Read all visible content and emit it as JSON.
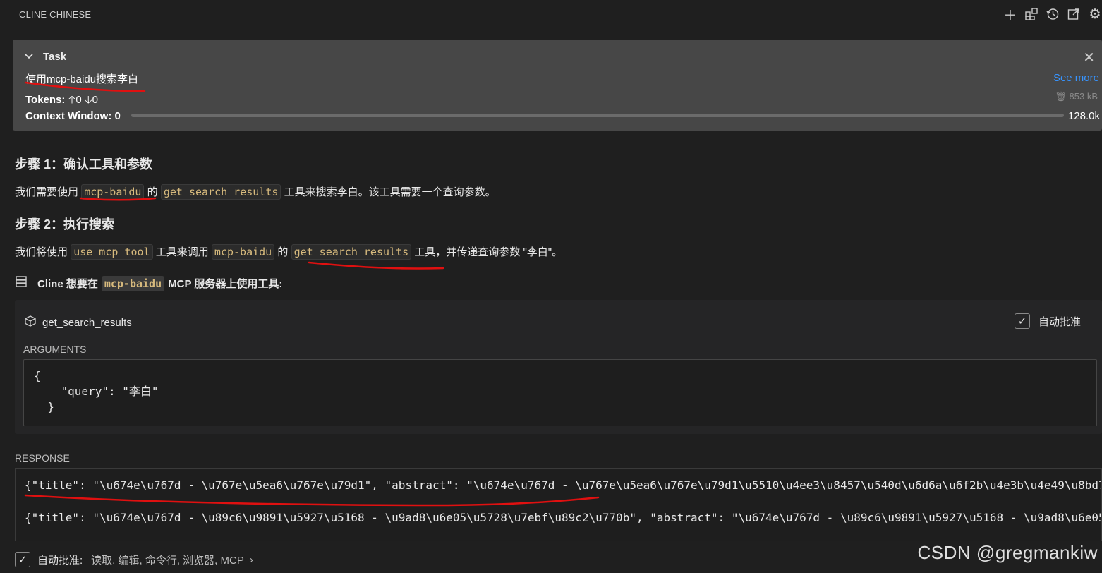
{
  "header": {
    "title": "CLINE CHINESE",
    "icons": [
      "plus-icon",
      "layout-icon",
      "history-icon",
      "popout-icon",
      "settings-icon"
    ]
  },
  "task": {
    "label": "Task",
    "text": "使用mcp-baidu搜索李白",
    "see_more": "See more",
    "tokens_label": "Tokens:",
    "tokens_up": "0",
    "tokens_down": "0",
    "size": "853 kB",
    "context_label": "Context Window:",
    "context_used": "0",
    "context_max": "128.0k",
    "context_fraction": 0
  },
  "step1": {
    "heading": "步骤 1：确认工具和参数",
    "p_pre": "我们需要使用",
    "code1": "mcp-baidu",
    "p_mid": "的",
    "code2": "get_search_results",
    "p_post": "工具来搜索李白。该工具需要一个查询参数。"
  },
  "step2": {
    "heading": "步骤 2：执行搜索",
    "p_pre": "我们将使用",
    "code1": "use_mcp_tool",
    "p_mid1": "工具来调用",
    "code2": "mcp-baidu",
    "p_mid2": "的",
    "code3": "get_search_results",
    "p_post": "工具，并传递查询参数 \"李白\"。"
  },
  "tool_header": {
    "pre": "Cline 想要在",
    "server": "mcp-baidu",
    "post": "MCP 服务器上使用工具:"
  },
  "tool_card": {
    "name": "get_search_results",
    "auto_approve": "自动批准",
    "arguments_label": "ARGUMENTS",
    "arguments_code": "{\n    \"query\": \"李白\"\n  }"
  },
  "response": {
    "label": "RESPONSE",
    "line1": "{\"title\": \"\\u674e\\u767d - \\u767e\\u5ea6\\u767e\\u79d1\", \"abstract\": \"\\u674e\\u767d - \\u767e\\u5ea6\\u767e\\u79d1\\u5510\\u4ee3\\u8457\\u540d\\u6d6a\\u6f2b\\u4e3b\\u4e49\\u8bd7",
    "line2": "{\"title\": \"\\u674e\\u767d - \\u89c6\\u9891\\u5927\\u5168 - \\u9ad8\\u6e05\\u5728\\u7ebf\\u89c2\\u770b\", \"abstract\": \"\\u674e\\u767d - \\u89c6\\u9891\\u5927\\u5168 - \\u9ad8\\u6e05"
  },
  "footer": {
    "label": "自动批准:",
    "items": "读取, 编辑, 命令行, 浏览器, MCP"
  },
  "watermark": "CSDN @gregmankiw",
  "colors": {
    "background": "#1f1f1f",
    "task_panel": "#474747",
    "link": "#3794ff",
    "code_text": "#d7ba7d",
    "annotation": "#e01010"
  }
}
